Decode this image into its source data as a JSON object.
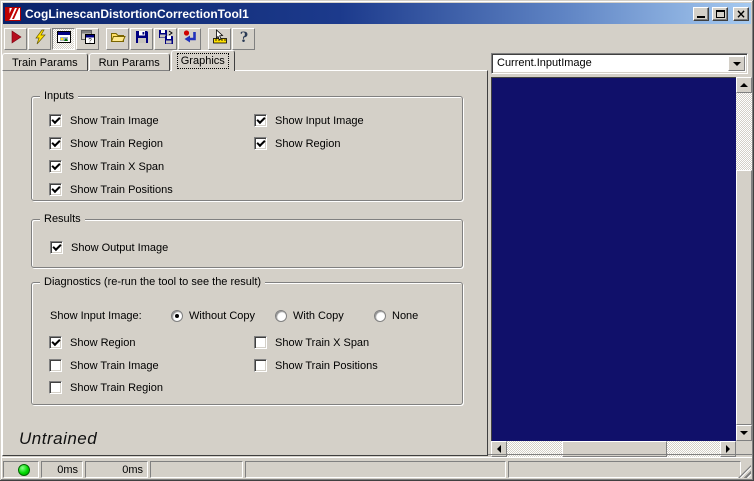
{
  "titlebar": {
    "title": "CogLinescanDistortionCorrectionTool1",
    "app_icon": "cognex-red-stripes",
    "buttons": [
      "minimize",
      "maximize",
      "close"
    ]
  },
  "toolbar": {
    "icons": [
      "run",
      "electric-run",
      "show-display",
      "float-display",
      "open-file",
      "save-file",
      "save-as",
      "reset",
      "graphics-ruler",
      "help"
    ],
    "pressed_button": "show-display"
  },
  "tabs": {
    "items": [
      {
        "label": "Train Params"
      },
      {
        "label": "Run Params"
      },
      {
        "label": "Graphics"
      }
    ],
    "selected": "Graphics"
  },
  "graphics_page": {
    "inputs": {
      "title": "Inputs",
      "col1": [
        {
          "label": "Show Train Image",
          "checked": true
        },
        {
          "label": "Show Train Region",
          "checked": true
        },
        {
          "label": "Show Train X Span",
          "checked": true
        },
        {
          "label": "Show Train Positions",
          "checked": true
        }
      ],
      "col2": [
        {
          "label": "Show Input Image",
          "checked": true
        },
        {
          "label": "Show Region",
          "checked": true
        }
      ]
    },
    "results": {
      "title": "Results",
      "col1": [
        {
          "label": "Show Output Image",
          "checked": true
        }
      ]
    },
    "diagnostics": {
      "title": "Diagnostics (re-run the tool to see the result)",
      "radio_group_label": "Show Input Image:",
      "radios": [
        {
          "label": "Without Copy",
          "selected": true
        },
        {
          "label": "With Copy",
          "selected": false
        },
        {
          "label": "None",
          "selected": false
        }
      ],
      "col1": [
        {
          "label": "Show Region",
          "checked": true
        },
        {
          "label": "Show Train Image",
          "checked": false
        },
        {
          "label": "Show Train Region",
          "checked": false
        }
      ],
      "col2": [
        {
          "label": "Show Train X Span",
          "checked": false
        },
        {
          "label": "Show Train Positions",
          "checked": false
        }
      ]
    },
    "state_label": "Untrained"
  },
  "display_panel": {
    "image_selector_value": "Current.InputImage",
    "image_background": "#10106a"
  },
  "statusbar": {
    "led": "green",
    "time1": "0ms",
    "time2": "0ms"
  },
  "colors": {
    "titlebar_start": "#0a246a",
    "titlebar_end": "#a6caf0",
    "face": "#d4d0c8",
    "image_bg": "#10106a",
    "led_green": "#00d800"
  }
}
